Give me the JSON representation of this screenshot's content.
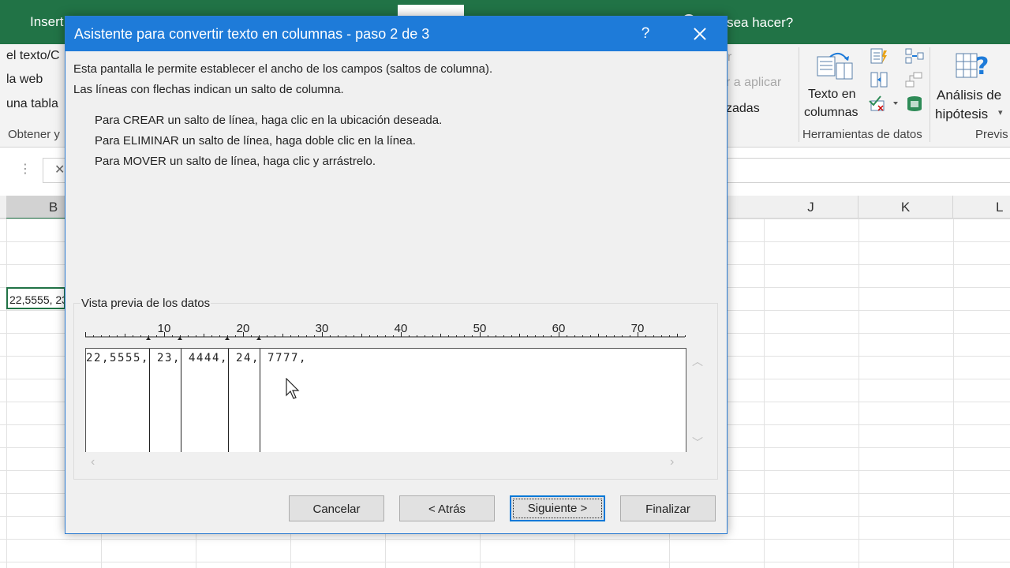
{
  "excel": {
    "tab_insert": "Insert",
    "tell_me": "é desea hacer?",
    "ribbon_left_line1": "el texto/C",
    "ribbon_left_line2": "la web",
    "ribbon_left_line3": "una tabla",
    "group_get": "Obtener y",
    "reapply_line1": "r",
    "reapply_line2": "r a aplicar",
    "advanced_partial": "zadas",
    "text_to_columns_line1": "Texto en",
    "text_to_columns_line2": "columnas",
    "group_data_tools": "Herramientas de datos",
    "whatif_line1": "Análisis de",
    "whatif_line2": "hipótesis",
    "group_forecast": "Previs",
    "column_b": "B",
    "column_j": "J",
    "column_k": "K",
    "column_l": "L",
    "cell_b_value": "22,5555, 23"
  },
  "dialog": {
    "title": "Asistente para convertir texto en columnas - paso 2 de 3",
    "help": "?",
    "intro_line1": "Esta pantalla le permite establecer el ancho de los campos (saltos de columna).",
    "intro_line2": "Las líneas con flechas indican un salto de columna.",
    "instr_create": "Para CREAR un salto de línea, haga clic en la ubicación deseada.",
    "instr_delete": "Para ELIMINAR un salto de línea, haga doble clic en la línea.",
    "instr_move": "Para MOVER un salto de línea, haga clic y arrástrelo.",
    "preview_label": "Vista previa de los datos",
    "ruler_labels": [
      "10",
      "20",
      "30",
      "40",
      "50",
      "60",
      "70"
    ],
    "preview_row": "22,5555, 23, 4444, 24, 7777,",
    "column_breaks": [
      8,
      12,
      18,
      22
    ],
    "buttons": {
      "cancel": "Cancelar",
      "back": "< Atrás",
      "next": "Siguiente >",
      "finish": "Finalizar"
    }
  },
  "colors": {
    "excel_green": "#217346",
    "title_blue": "#1e7bd9",
    "dialog_bg": "#f0f0f0",
    "focus_blue": "#0078d7"
  }
}
